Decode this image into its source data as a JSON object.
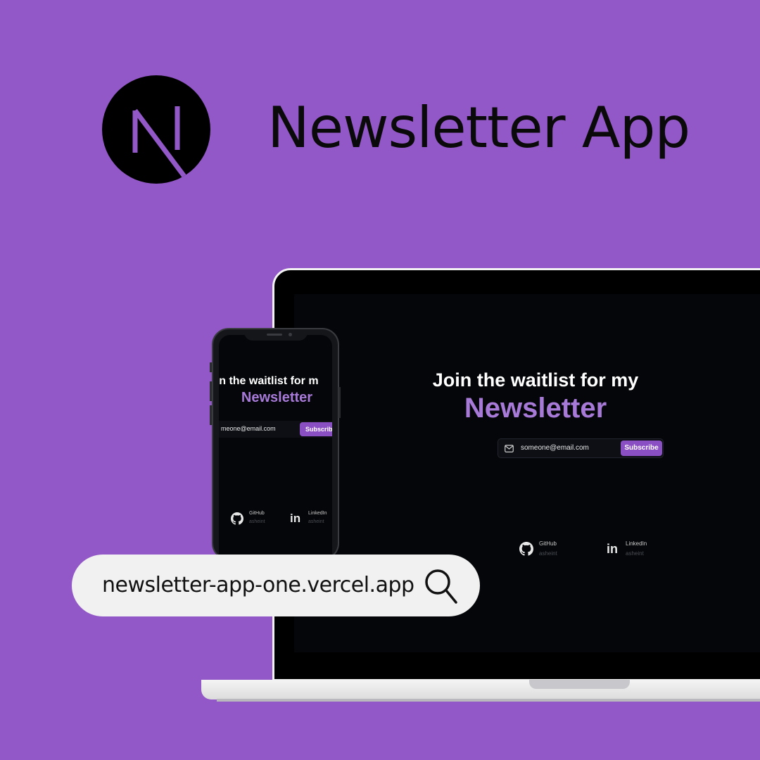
{
  "header": {
    "title": "Newsletter App"
  },
  "site": {
    "heading": "Join the waitlist for my",
    "heading_mobile": "oin the waitlist for m",
    "accent": "Newsletter",
    "email_value": "someone@email.com",
    "email_value_mobile": "meone@email.com",
    "subscribe_label": "Subscribe",
    "subscribe_label_mobile": "Subscribe",
    "socials": [
      {
        "name": "GitHub",
        "handle": "asheint",
        "icon": "github-icon"
      },
      {
        "name": "LinkedIn",
        "handle": "asheint",
        "icon": "linkedin-icon"
      }
    ]
  },
  "urlbar": {
    "url": "newsletter-app-one.vercel.app",
    "icon": "search-icon"
  },
  "colors": {
    "background": "#9358c7",
    "accent": "#a77ad8",
    "button": "#8b4fc4",
    "screen": "#050609"
  }
}
